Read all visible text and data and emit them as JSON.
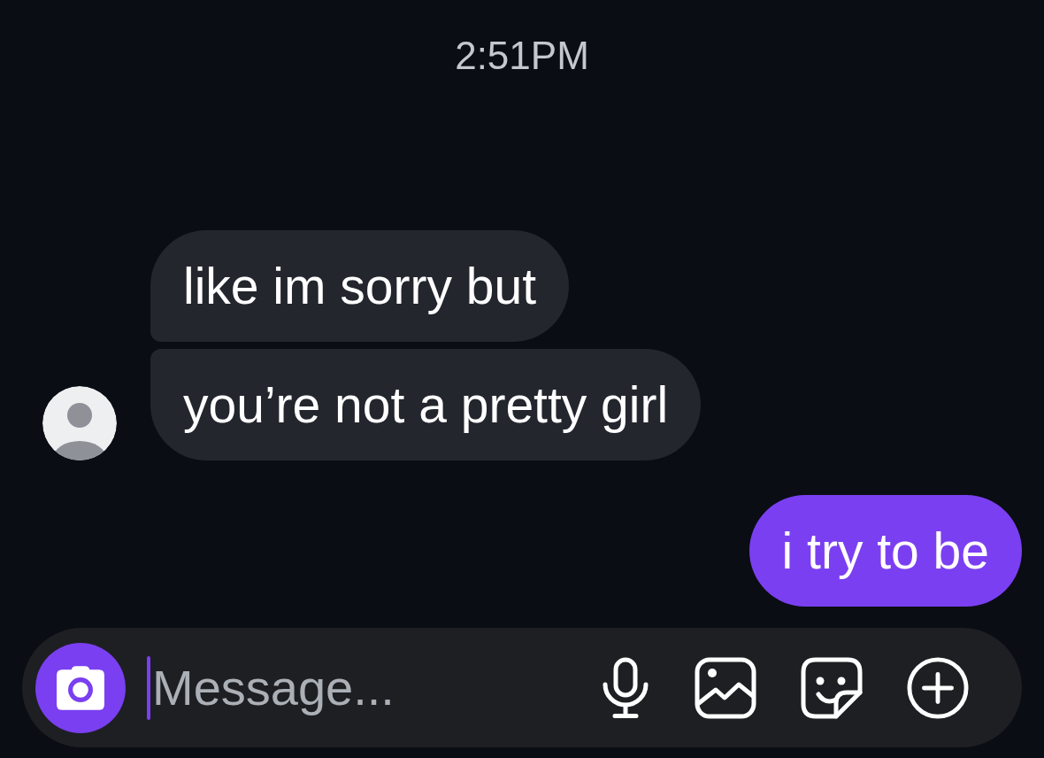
{
  "timestamp": "2:51PM",
  "messages": [
    {
      "kind": "received",
      "text": "like im sorry but",
      "avatar": false
    },
    {
      "kind": "received",
      "text": "you’re not a pretty girl",
      "avatar": true
    },
    {
      "kind": "sent",
      "text": "i try to be"
    }
  ],
  "composer": {
    "placeholder": "Message...",
    "focused": true
  }
}
